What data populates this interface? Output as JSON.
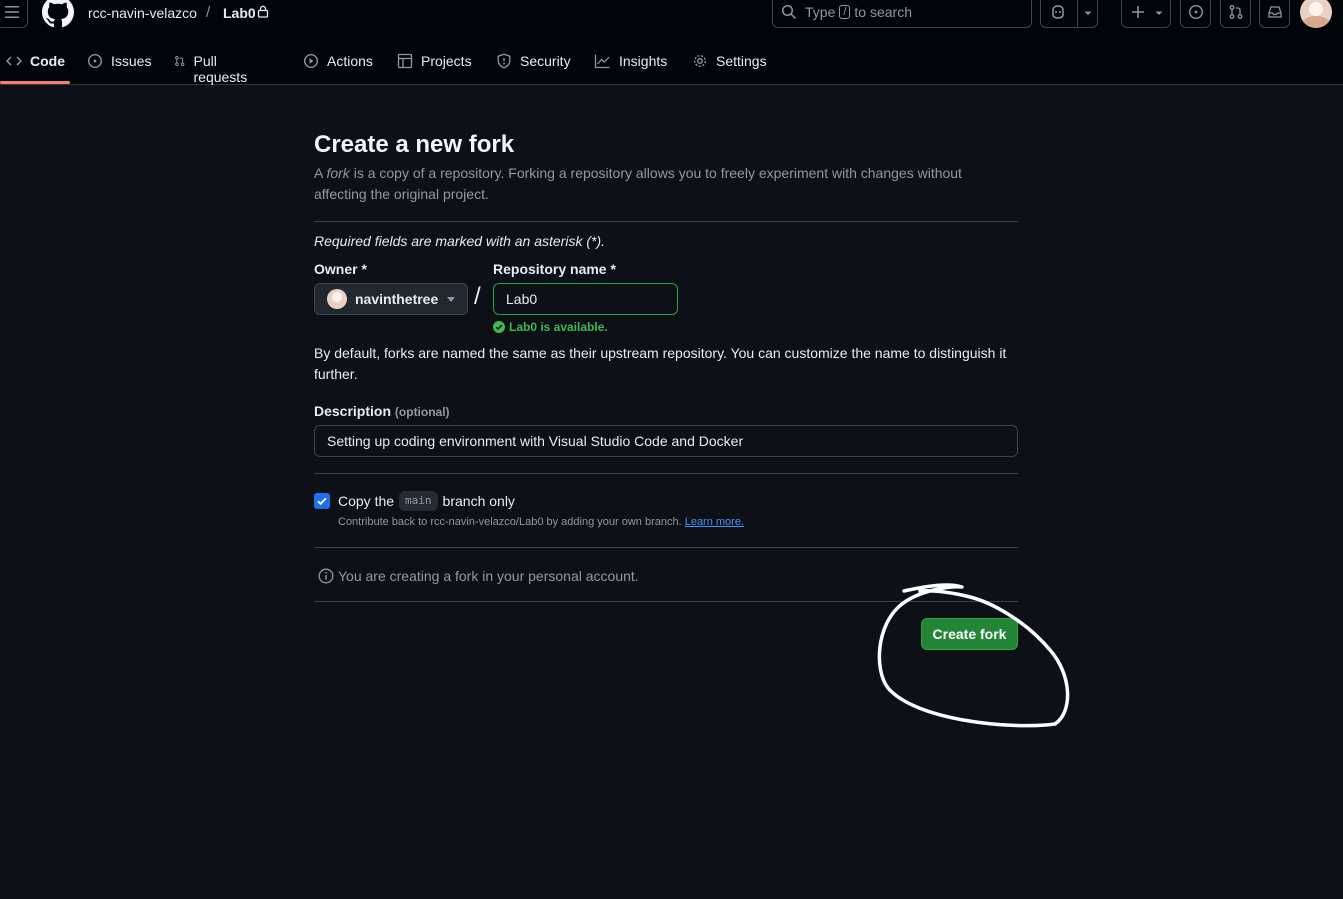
{
  "header": {
    "owner": "rcc-navin-velazco",
    "separator": "/",
    "repo": "Lab0",
    "search": {
      "before": "Type",
      "key": "/",
      "after": "to search"
    }
  },
  "nav": {
    "tabs": [
      {
        "label": "Code",
        "icon": "code-icon",
        "active": true
      },
      {
        "label": "Issues",
        "icon": "issue-icon"
      },
      {
        "label": "Pull requests",
        "icon": "pull-request-icon"
      },
      {
        "label": "Actions",
        "icon": "play-icon"
      },
      {
        "label": "Projects",
        "icon": "table-icon"
      },
      {
        "label": "Security",
        "icon": "shield-icon"
      },
      {
        "label": "Insights",
        "icon": "graph-icon"
      },
      {
        "label": "Settings",
        "icon": "gear-icon"
      }
    ]
  },
  "form": {
    "title": "Create a new fork",
    "lead_before": "A ",
    "lead_fork": "fork",
    "lead_after": " is a copy of a repository. Forking a repository allows you to freely experiment with changes without affecting the original project.",
    "required_note": "Required fields are marked with an asterisk (*).",
    "owner_label": "Owner *",
    "owner_value": "navinthetree",
    "repo_label": "Repository name *",
    "repo_value": "Lab0",
    "availability": "Lab0 is available.",
    "naming_note": "By default, forks are named the same as their upstream repository. You can customize the name to distinguish it further.",
    "description_label": "Description",
    "description_optional": "(optional)",
    "description_value": "Setting up coding environment with Visual Studio Code and Docker",
    "copy_before": "Copy the",
    "copy_branch": "main",
    "copy_after": "branch only",
    "copy_checked": true,
    "copy_help": "Contribute back to rcc-navin-velazco/Lab0 by adding your own branch.",
    "learn_more": "Learn more.",
    "account_note": "You are creating a fork in your personal account.",
    "submit": "Create fork"
  },
  "colors": {
    "background": "#0d1117",
    "primary_button": "#238636",
    "accent_underline": "#f78166",
    "success": "#3fb950",
    "link": "#4493f8"
  }
}
